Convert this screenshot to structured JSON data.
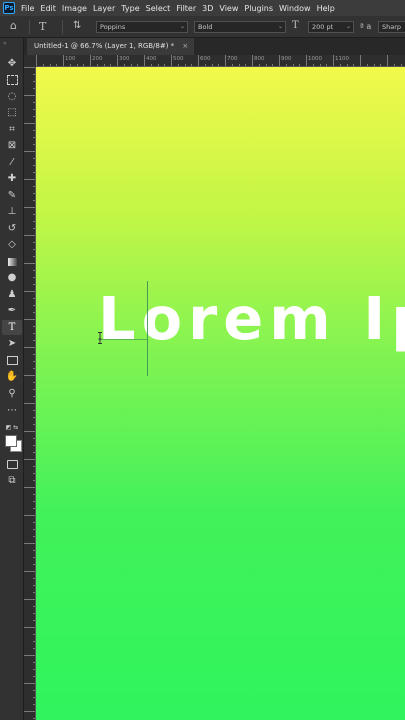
{
  "app": {
    "logo": "Ps"
  },
  "menu": [
    "File",
    "Edit",
    "Image",
    "Layer",
    "Type",
    "Select",
    "Filter",
    "3D",
    "View",
    "Plugins",
    "Window",
    "Help"
  ],
  "options": {
    "font_family": "Poppins",
    "font_style": "Bold",
    "font_size": "200 pt",
    "antialias_icon_text": "ª a",
    "antialias": "Sharp"
  },
  "document": {
    "tab_title": "Untitled-1 @ 66.7% (Layer 1, RGB/8#) *",
    "close_glyph": "×"
  },
  "ruler": {
    "top_labels": [
      "100",
      "200",
      "300",
      "400",
      "500",
      "600",
      "700",
      "800",
      "900",
      "1000",
      "1100"
    ]
  },
  "canvas": {
    "text": "Lorem Ipsum",
    "gradient_top": "#f2f94b",
    "gradient_bottom": "#2ff45d"
  },
  "icons": {
    "home": "⌂",
    "type_tool": "T",
    "orient": "⇅",
    "size": "T"
  }
}
